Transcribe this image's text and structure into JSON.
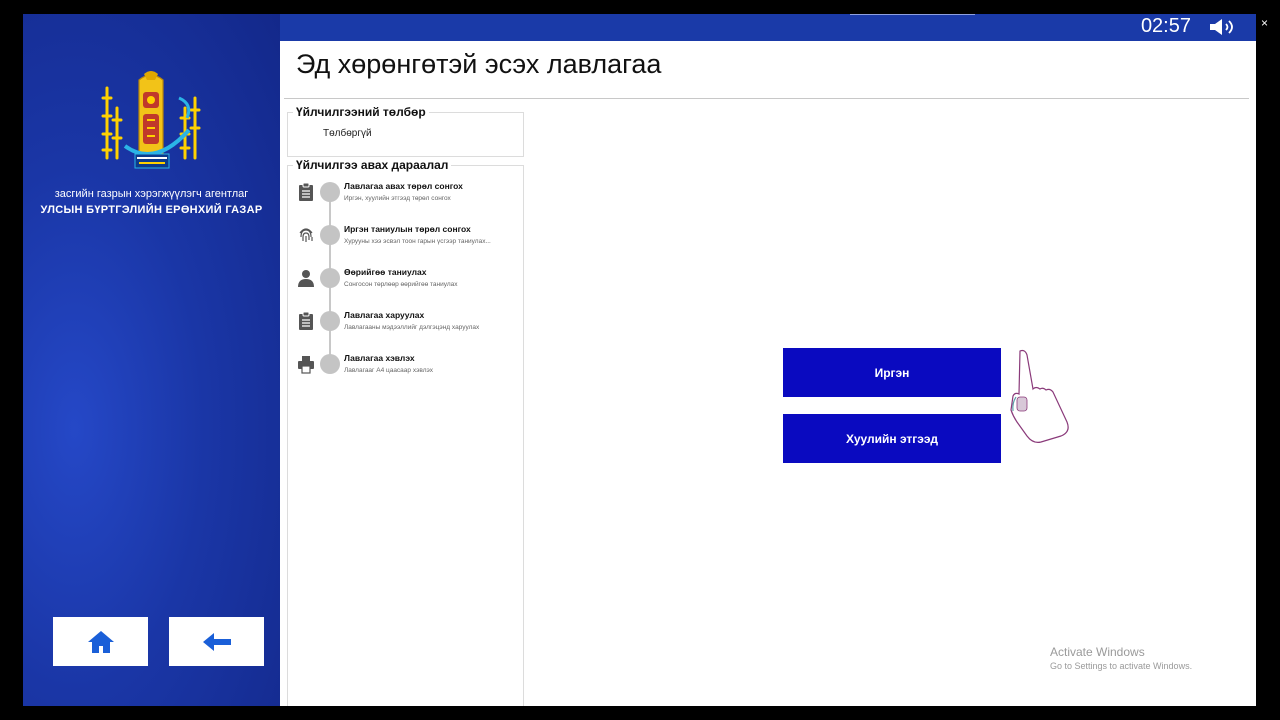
{
  "sidebar": {
    "agency": "засгийн газрын хэрэгжүүлэгч агентлаг",
    "department": "УЛСЫН БҮРТГЭЛИЙН ЕРӨНХИЙ ГАЗАР",
    "emblem_text": "УЛСЫН БҮРТГЭЛИЙН ЕРӨНХИЙ ГАЗАР",
    "home_icon": "home-icon",
    "back_icon": "arrow-left-icon"
  },
  "topbar": {
    "timer": "02:57",
    "speaker_icon": "speaker-icon",
    "close": "×"
  },
  "main": {
    "title": "Эд хөрөнгөтэй эсэх лавлагаа",
    "payment": {
      "legend": "Үйлчилгээний төлбөр",
      "value": "Төлбөргүй"
    },
    "steps": {
      "legend": "Үйлчилгээ авах дараалал",
      "items": [
        {
          "icon": "clipboard-icon",
          "title": "Лавлагаа авах төрөл сонгох",
          "desc": "Иргэн, хуулийн этгээд төрөл сонгох"
        },
        {
          "icon": "fingerprint-icon",
          "title": "Иргэн таниулын төрөл сонгох",
          "desc": "Хурууны хээ эсвэл тоон гарын үсгээр таниулах..."
        },
        {
          "icon": "user-icon",
          "title": "Өөрийгөө таниулах",
          "desc": "Сонгосон төрлөөр өөрийгөө таниулах"
        },
        {
          "icon": "clipboard-icon",
          "title": "Лавлагаа харуулах",
          "desc": "Лавлагааны мэдээллийг дэлгэцэнд харуулах"
        },
        {
          "icon": "printer-icon",
          "title": "Лавлагаа хэвлэх",
          "desc": "Лавлагааг А4 цаасаар хэвлэх"
        }
      ]
    },
    "choices": {
      "citizen": "Иргэн",
      "legal_entity": "Хуулийн этгээд"
    },
    "watermark": {
      "line1": "Activate Windows",
      "line2": "Go to Settings to activate Windows."
    }
  },
  "colors": {
    "sidebar": "#1a36a6",
    "choice_button": "#0a0ac0",
    "nav_icon": "#1a5fd8"
  }
}
